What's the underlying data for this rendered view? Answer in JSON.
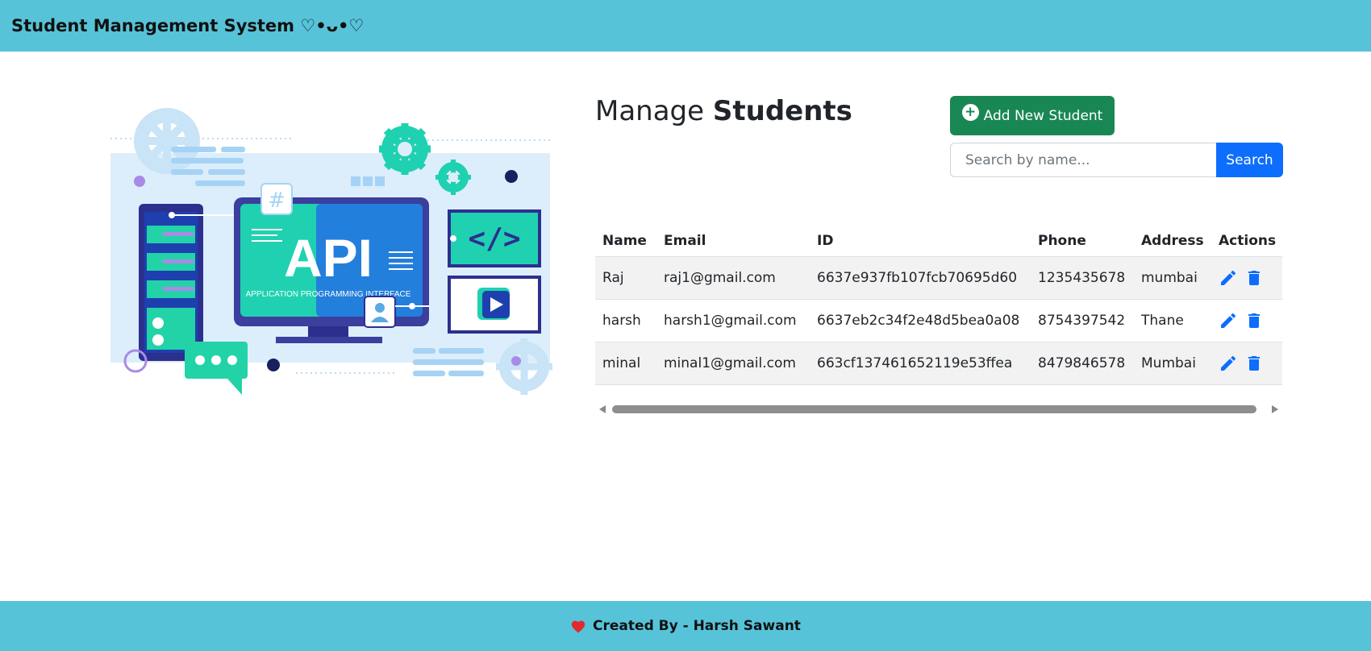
{
  "navbar": {
    "brand": "Student Management System ♡•ᴗ•♡"
  },
  "hero": {
    "illustration": "api-illustration",
    "api_text": "API",
    "api_caption": "APPLICATION PROGRAMMING INTERFACE"
  },
  "manage": {
    "title_plain": "Manage ",
    "title_bold": "Students",
    "add_button_label": "Add New Student",
    "add_icon": "plus-circle-icon"
  },
  "search": {
    "placeholder": "Search by name...",
    "value": "",
    "button_label": "Search"
  },
  "table": {
    "headers": [
      "Name",
      "Email",
      "ID",
      "Phone",
      "Address",
      "Actions"
    ],
    "rows": [
      {
        "name": "Raj",
        "email": "raj1@gmail.com",
        "id": "6637e937fb107fcb70695d60",
        "phone": "1235435678",
        "address": "mumbai"
      },
      {
        "name": "harsh",
        "email": "harsh1@gmail.com",
        "id": "6637eb2c34f2e48d5bea0a08",
        "phone": "8754397542",
        "address": "Thane"
      },
      {
        "name": "minal",
        "email": "minal1@gmail.com",
        "id": "663cf137461652119e53ffea",
        "phone": "8479846578",
        "address": "Mumbai"
      }
    ],
    "action_icons": [
      "pencil-icon",
      "trash-icon"
    ]
  },
  "footer": {
    "text": "Created By - Harsh Sawant",
    "icon": "heart-icon"
  },
  "colors": {
    "navbar": "#56c3d9",
    "add_button": "#198754",
    "search_button": "#0d6efd",
    "action_icon": "#0d6efd"
  }
}
